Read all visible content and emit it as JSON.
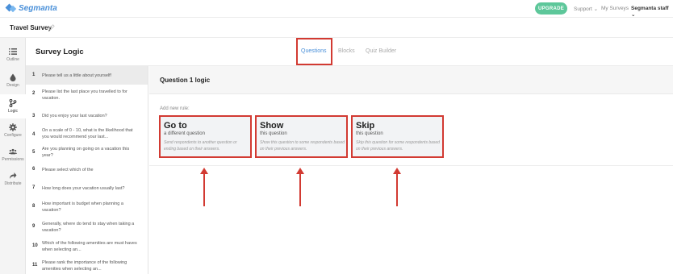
{
  "header": {
    "logo": "Segmanta",
    "upgrade_label": "UPGRADE",
    "support_label": "Support ⌄",
    "my_surveys_label": "My Surveys",
    "account_label": "Segmanta staff ⌄"
  },
  "survey": {
    "title": "Travel Survey"
  },
  "sidebar": {
    "items": [
      {
        "label": "Outline",
        "icon": "list-icon"
      },
      {
        "label": "Design",
        "icon": "droplet-icon"
      },
      {
        "label": "Logic",
        "icon": "branch-icon"
      },
      {
        "label": "Configure",
        "icon": "gear-icon"
      },
      {
        "label": "Permissions",
        "icon": "users-icon"
      },
      {
        "label": "Distribute",
        "icon": "share-icon"
      }
    ]
  },
  "logic": {
    "title": "Survey Logic",
    "tabs": [
      {
        "label": "Questions"
      },
      {
        "label": "Blocks"
      },
      {
        "label": "Quiz Builder"
      }
    ]
  },
  "questions": [
    {
      "num": "1",
      "text": "Please tell us a little about yourself!"
    },
    {
      "num": "2",
      "text": "Please list the last place you travelled to for vacation."
    },
    {
      "num": "3",
      "text": "Did you enjoy your last vacation?"
    },
    {
      "num": "4",
      "text": "On a scale of 0 - 10, what is the likelihood that you would recommend your last..."
    },
    {
      "num": "5",
      "text": "Are you planning on going on a vacation this year?"
    },
    {
      "num": "6",
      "text": "Please select which of the"
    },
    {
      "num": "7",
      "text": "How long does your vacation usually last?"
    },
    {
      "num": "8",
      "text": "How important is budget when planning a vacation?"
    },
    {
      "num": "9",
      "text": "Generally, where do tend to stay when taking a vacation?"
    },
    {
      "num": "10",
      "text": "Which of the following amenities are must haves when selecting an..."
    },
    {
      "num": "11",
      "text": "Please rank the importance of the following amenities when selecting an..."
    }
  ],
  "main": {
    "heading": "Question 1 logic",
    "add_rule_label": "Add new rule:",
    "rules": [
      {
        "title": "Go to",
        "subtitle": "a different question",
        "description": "Send respondents to another question or ending based on their answers."
      },
      {
        "title": "Show",
        "subtitle": "this question",
        "description": "Show this question to some respondents based on their previous answers."
      },
      {
        "title": "Skip",
        "subtitle": "this question",
        "description": "Skip this question for some respondents based on their previous answers."
      }
    ]
  },
  "colors": {
    "accent": "#4a90d9",
    "upgrade": "#5dc79a",
    "highlight": "#d23a32"
  }
}
